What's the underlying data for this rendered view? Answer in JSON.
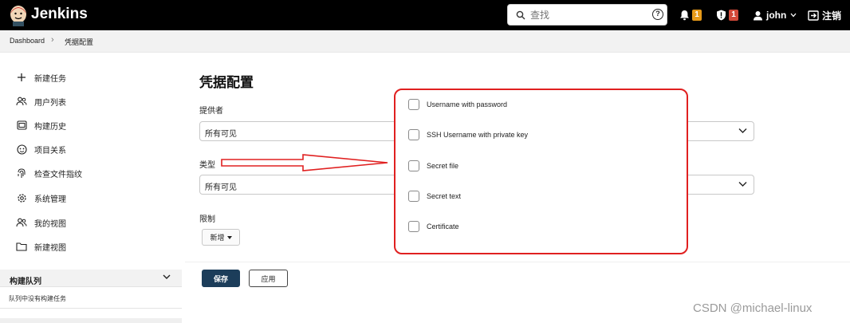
{
  "header": {
    "brand": "Jenkins",
    "search_placeholder": "查找",
    "notifications_count": "1",
    "security_count": "1",
    "user": "john",
    "logout": "注销"
  },
  "breadcrumb": {
    "items": [
      "Dashboard",
      "凭据配置"
    ]
  },
  "sidebar": {
    "items": [
      {
        "label": "新建任务",
        "icon": "plus-icon"
      },
      {
        "label": "用户列表",
        "icon": "users-icon"
      },
      {
        "label": "构建历史",
        "icon": "history-icon"
      },
      {
        "label": "项目关系",
        "icon": "relation-icon"
      },
      {
        "label": "检查文件指纹",
        "icon": "fingerprint-icon"
      },
      {
        "label": "系统管理",
        "icon": "gear-icon"
      },
      {
        "label": "我的视图",
        "icon": "people-icon"
      },
      {
        "label": "新建视图",
        "icon": "folder-icon"
      }
    ],
    "queue_title": "构建队列",
    "queue_empty": "队列中没有构建任务"
  },
  "form": {
    "title": "凭据配置",
    "provider_label": "提供者",
    "provider_value": "所有可见",
    "type_label": "类型",
    "type_value": "所有可见",
    "restrict_label": "限制",
    "add_button": "新增",
    "save_button": "保存",
    "apply_button": "应用"
  },
  "popup": {
    "options": [
      "Username with password",
      "SSH Username with private key",
      "Secret file",
      "Secret text",
      "Certificate"
    ]
  },
  "watermark": "CSDN @michael-linux",
  "colors": {
    "header_bg": "#000000",
    "accent_red": "#e02020",
    "save_bg": "#1c3d5a",
    "badge_orange": "#e79a19",
    "badge_red": "#d24939"
  }
}
